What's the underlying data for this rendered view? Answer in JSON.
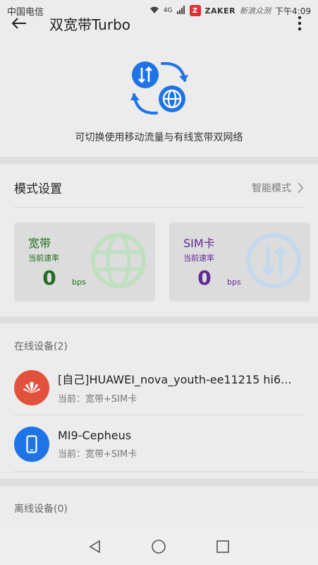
{
  "status_bar": {
    "carrier": "中国电信",
    "signal_label": "4G",
    "notif_badge": "Z",
    "brand": "ZAKER",
    "watermark": "新浪众测",
    "time": "下午4:09"
  },
  "header": {
    "title": "双宽带Turbo"
  },
  "hero": {
    "description": "可切换使用移动流量与有线宽带双网络",
    "icon": "dual-network-icon",
    "accent_color": "#1e74e6"
  },
  "mode": {
    "label": "模式设置",
    "value": "智能模式"
  },
  "cards": [
    {
      "title": "宽带",
      "subtitle": "当前速率",
      "value": "0",
      "unit": "bps",
      "color": "#1f6d1f",
      "icon": "globe-icon"
    },
    {
      "title": "SIM卡",
      "subtitle": "当前速率",
      "value": "0",
      "unit": "bps",
      "color": "#5e2b94",
      "icon": "data-transfer-icon"
    }
  ],
  "online": {
    "header": "在线设备(2)",
    "devices": [
      {
        "name": "[自己]HUAWEI_nova_youth-ee11215 hi6...",
        "status": "当前：宽带+SIM卡",
        "icon": "huawei-logo-icon"
      },
      {
        "name": "MI9-Cepheus",
        "status": "当前：宽带+SIM卡",
        "icon": "phone-icon"
      }
    ]
  },
  "offline": {
    "header": "离线设备(0)"
  }
}
